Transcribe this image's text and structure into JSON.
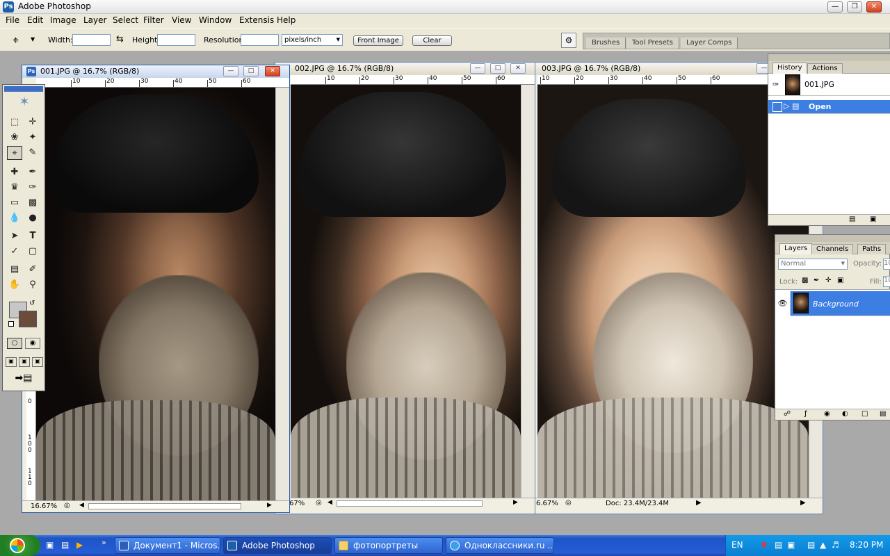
{
  "app": {
    "title": "Adobe Photoshop"
  },
  "menu": [
    "File",
    "Edit",
    "Image",
    "Layer",
    "Select",
    "Filter",
    "View",
    "Window",
    "Extensis",
    "Help"
  ],
  "options": {
    "width_label": "Width:",
    "height_label": "Height:",
    "resolution_label": "Resolution:",
    "units_value": "pixels/inch",
    "front_image_label": "Front Image",
    "clear_label": "Clear",
    "palette_tabs": [
      "Brushes",
      "Tool Presets",
      "Layer Comps"
    ]
  },
  "documents": [
    {
      "title": "001.JPG @ 16.7% (RGB/8)",
      "status_zoom": "16.67%",
      "active": true
    },
    {
      "title": "002.JPG @ 16.7% (RGB/8)",
      "status_zoom": "67%"
    },
    {
      "title": "003.JPG @ 16.7% (RGB/8)",
      "status_zoom": "6.67%",
      "doc_info": "Doc: 23.4M/23.4M"
    }
  ],
  "ruler_ticks": [
    "10",
    "20",
    "30",
    "40",
    "50",
    "60"
  ],
  "vruler_labels": [
    "0",
    "1\n0\n0",
    "1\n1\n0"
  ],
  "history": {
    "tabs": [
      "History",
      "Actions"
    ],
    "snapshot": "001.JPG",
    "items": [
      {
        "label": "Open",
        "selected": true
      }
    ]
  },
  "layers": {
    "tabs": [
      "Layers",
      "Channels",
      "Paths"
    ],
    "blend_mode": "Normal",
    "opacity_label": "Opacity:",
    "opacity_value": "10",
    "lock_label": "Lock:",
    "fill_label": "Fill:",
    "fill_value": "10",
    "items": [
      {
        "name": "Background"
      }
    ]
  },
  "taskbar": {
    "items": [
      {
        "label": "Документ1 - Micros..."
      },
      {
        "label": "Adobe Photoshop",
        "active": true
      },
      {
        "label": "фотопортреты"
      },
      {
        "label": "Одноклассники.ru ..."
      }
    ],
    "lang": "EN",
    "clock": "8:20 PM"
  },
  "colors": {
    "accent": "#3d7ee2",
    "taskbar": "#245dd6"
  }
}
